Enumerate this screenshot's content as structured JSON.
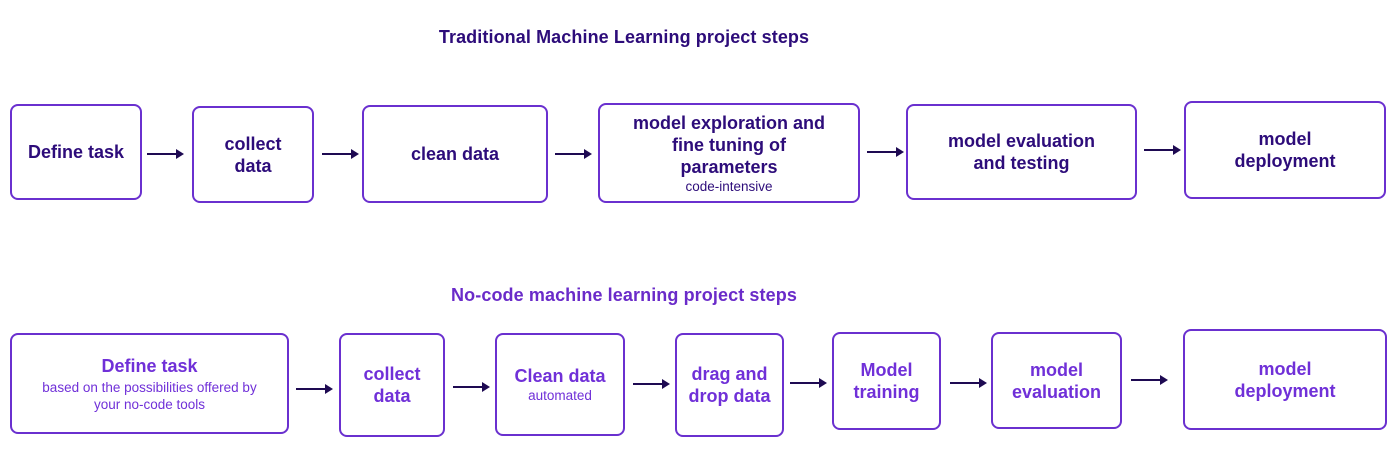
{
  "traditional": {
    "title": "Traditional Machine Learning project steps",
    "steps": [
      {
        "label": "Define task",
        "sub": ""
      },
      {
        "label": "collect\ndata",
        "sub": ""
      },
      {
        "label": "clean data",
        "sub": ""
      },
      {
        "label": "model exploration and\nfine tuning of\nparameters",
        "sub": "code-intensive"
      },
      {
        "label": "model evaluation\nand testing",
        "sub": ""
      },
      {
        "label": "model\ndeployment",
        "sub": ""
      }
    ]
  },
  "nocode": {
    "title": "No-code machine learning project steps",
    "steps": [
      {
        "label": "Define task",
        "sub": "based on the possibilities offered by\nyour no-code tools"
      },
      {
        "label": "collect\ndata",
        "sub": ""
      },
      {
        "label": "Clean data",
        "sub": "automated"
      },
      {
        "label": "drag and\ndrop data",
        "sub": ""
      },
      {
        "label": "Model\ntraining",
        "sub": ""
      },
      {
        "label": "model\nevaluation",
        "sub": ""
      },
      {
        "label": "model\ndeployment",
        "sub": ""
      }
    ]
  },
  "colors": {
    "border": "#6a30cf",
    "dark_text": "#2d0c7a",
    "light_text": "#7030d8",
    "arrow": "#1e0a52"
  }
}
